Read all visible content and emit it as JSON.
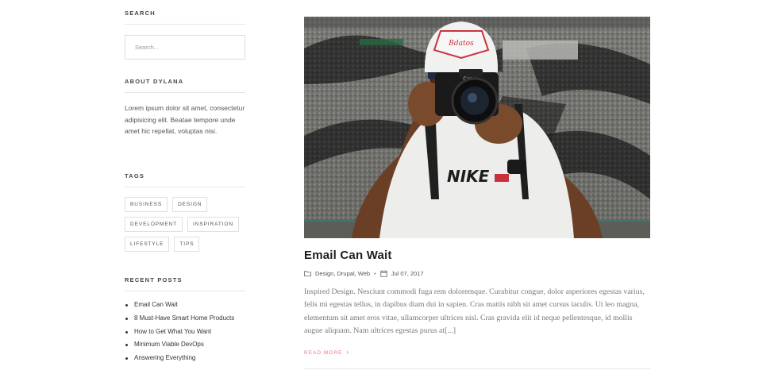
{
  "sidebar": {
    "search": {
      "title": "SEARCH",
      "placeholder": "Search..."
    },
    "about": {
      "title": "ABOUT DYLANA",
      "text": "Lorem ipsum dolor sit amet, consectetur adipisicing elit. Beatae tempore unde amet hic repellat, voluptas nisi."
    },
    "tags": {
      "title": "TAGS",
      "items": [
        "BUSINESS",
        "DESIGN",
        "DEVELOPMENT",
        "INSPIRATION",
        "LIFESTYLE",
        "TIPS"
      ]
    },
    "recent_posts": {
      "title": "RECENT POSTS",
      "items": [
        "Email Can Wait",
        "8 Must-Have Smart Home Products",
        "How to Get What You Want",
        "Minimum Viable DevOps",
        "Answering Everything"
      ]
    }
  },
  "post": {
    "image_alt": "Photographer holding a Canon camera",
    "image_cap_text": "Bdatos",
    "image_camera_text": "Canon",
    "image_shirt_text": "NIKE",
    "title": "Email Can Wait",
    "categories": "Design, Drupal, Web",
    "date": "Jul 07, 2017",
    "excerpt": "Inspired Design. Nesciunt commodi fuga rem doloremque. Curabitur congue, dolor asperiores egestas varius, felis mi egestas tellus, in dapibus diam dui in sapien. Cras mattis nibh sit amet cursus iaculis. Ut leo magna, elementum sit amet eros vitae, ullamcorper ultrices nisl. Cras gravida elit id neque pellentesque, id mollis augue aliquam. Nam ultrices egestas purus at[...]",
    "read_more": "READ MORE",
    "read_more_arrow": "›"
  },
  "colors": {
    "accent": "#e37c86",
    "divider": "#e6e6e6",
    "body_text": "#777777"
  }
}
